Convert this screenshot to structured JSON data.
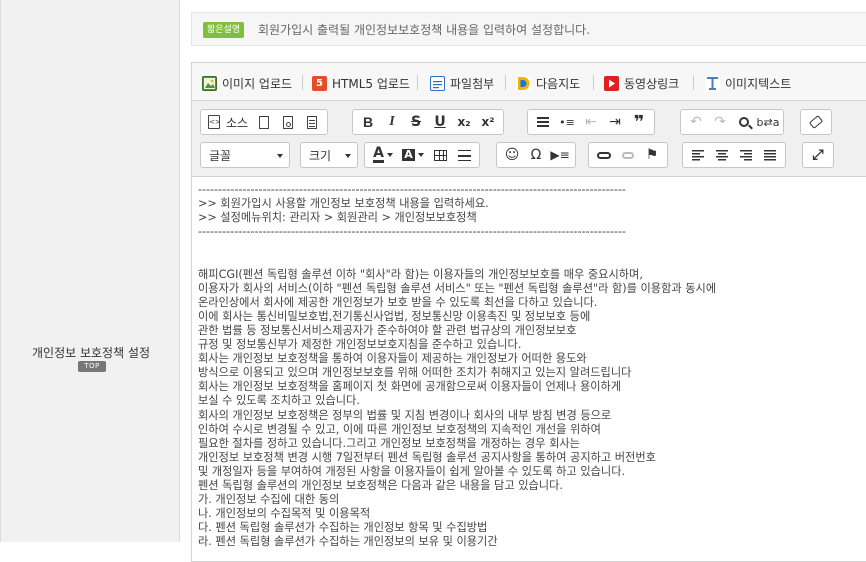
{
  "left": {
    "field_label": "개인정보 보호정책 설정",
    "top_badge": "TOP"
  },
  "info": {
    "badge": "짧은설명",
    "text": "회원가입시 출력될 개인정보보호정책 내용을 입력하여 설정합니다."
  },
  "topbar": {
    "image_upload": "이미지 업로드",
    "html5_upload": "HTML5 업로드",
    "file_attach": "파일첨부",
    "daum_map": "다음지도",
    "video_link": "동영상링크",
    "image_text": "이미지텍스트"
  },
  "toolbar": {
    "source_label": "소스",
    "font_label": "글꼴",
    "size_label": "크기",
    "bold": "B",
    "italic": "I",
    "strike": "S",
    "underline": "U",
    "subscript": "x₂",
    "superscript": "x²",
    "quote": "❞",
    "omega": "Ω",
    "text_color": "A",
    "bg_color": "A"
  },
  "content_lines": [
    "----------------------------------------------------------------------------------------------------------",
    ">> 회원가입시 사용할 개인정보 보호정책 내용을 입력하세요.",
    ">> 설정메뉴위치: 관리자 > 회원관리 > 개인정보보호정책",
    "----------------------------------------------------------------------------------------------------------",
    "",
    "",
    "해피CGI(펜션 독립형 솔루션 이하 \"회사\"라 함)는 이용자들의 개인정보보호를 매우 중요시하며,",
    "이용자가 회사의 서비스(이하 \"펜션 독립형 솔루션 서비스\" 또는 \"펜션 독립형 솔루션\"라 함)를 이용함과 동시에",
    "온라인상에서 회사에 제공한 개인정보가 보호 받을 수 있도록 최선을 다하고 있습니다.",
    "이에 회사는 통신비밀보호법,전기통신사업법, 정보통신망 이용촉진 및 정보보호 등에",
    "관한 법률 등 정보통신서비스제공자가 준수하여야 할 관련 법규상의 개인정보보호",
    "규정 및 정보통신부가 제정한 개인정보보호지침을 준수하고 있습니다.",
    "회사는 개인정보 보호정책을 통하여 이용자들이 제공하는 개인정보가 어떠한 용도와",
    "방식으로 이용되고 있으며 개인정보보호를 위해 어떠한 조치가 취해지고 있는지 알려드립니다",
    "회사는 개인정보 보호정책을 홈페이지 첫 화면에 공개함으로써 이용자들이 언제나 용이하게",
    "보실 수 있도록 조치하고 있습니다.",
    "회사의 개인정보 보호정책은 정부의 법률 및 지침 변경이나 회사의 내부 방침 변경 등으로",
    "인하여 수시로 변경될 수 있고, 이에 따른 개인정보 보호정책의 지속적인 개선을 위하여",
    "필요한 절차를 정하고 있습니다.그리고 개인정보 보호정책을 개정하는 경우 회사는",
    "개인정보 보호정책 변경 시행 7일전부터 펜션 독립형 솔루션 공지사항을 통하여 공지하고 버전번호",
    "및 개정일자 등을 부여하여 개정된 사항을 이용자들이 쉽게 알아볼 수 있도록 하고 있습니다.",
    "펜션 독립형 솔루션의 개인정보 보호정책은 다음과 같은 내용을 담고 있습니다.",
    "가. 개인정보 수집에 대한 동의",
    "나. 개인정보의 수집목적 및 이용목적",
    "다. 펜션 독립형 솔루션가 수집하는 개인정보 항목 및 수집방법",
    "라. 펜션 독립형 솔루션가 수집하는 개인정보의 보유 및 이용기간"
  ],
  "colors": {
    "badge_green": "#7fbf3f",
    "html5_orange": "#e44d26",
    "daum_blue": "#1a73e8",
    "video_red": "#e02020"
  }
}
